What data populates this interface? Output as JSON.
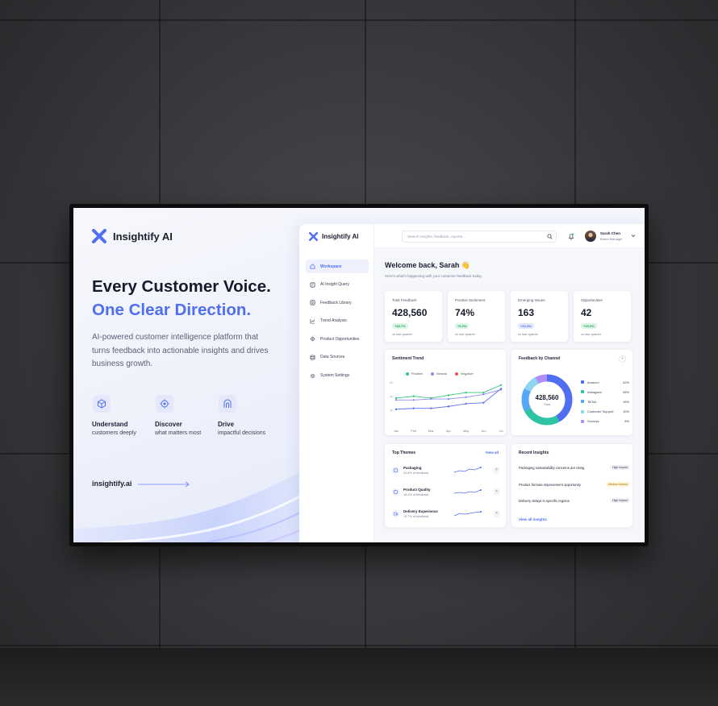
{
  "hero": {
    "brand": "Insightify AI",
    "headline_line1": "Every Customer Voice.",
    "headline_line2": "One Clear Direction.",
    "description": "AI-powered customer intelligence platform that turns feedback into actionable insights and drives business growth.",
    "features": [
      {
        "title": "Understand",
        "subtitle": "customers deeply",
        "icon": "cube-icon"
      },
      {
        "title": "Discover",
        "subtitle": "what matters most",
        "icon": "target-icon"
      },
      {
        "title": "Drive",
        "subtitle": "impactful decisions",
        "icon": "arch-icon"
      }
    ],
    "site": "insightify.ai"
  },
  "app": {
    "brand": "Insightify AI",
    "nav": [
      {
        "label": "Workspace",
        "icon": "home-icon",
        "active": true
      },
      {
        "label": "AI Insight Query",
        "icon": "query-icon",
        "active": false
      },
      {
        "label": "Feedback Library",
        "icon": "library-icon",
        "active": false
      },
      {
        "label": "Trend Analysis",
        "icon": "trend-icon",
        "active": false
      },
      {
        "label": "Product Opportunities",
        "icon": "lightbulb-icon",
        "active": false
      },
      {
        "label": "Data Sources",
        "icon": "database-icon",
        "active": false
      },
      {
        "label": "System Settings",
        "icon": "gear-icon",
        "active": false
      }
    ],
    "search_placeholder": "Search insights, feedback, reports...",
    "user": {
      "name": "Sarah Chen",
      "role": "Brand Manager"
    },
    "welcome": "Welcome back, Sarah 👋",
    "welcome_sub": "Here's what's happening with your customer feedback today.",
    "stats": [
      {
        "label": "Total Feedback",
        "value": "428,560",
        "change": "+18.7%",
        "change_color": "green",
        "sub": "vs last quarter"
      },
      {
        "label": "Positive Sentiment",
        "value": "74%",
        "change": "+6.2%",
        "change_color": "green",
        "sub": "vs last quarter"
      },
      {
        "label": "Emerging Issues",
        "value": "163",
        "change": "+23.4%",
        "change_color": "blue",
        "sub": "vs last quarter"
      },
      {
        "label": "Opportunities",
        "value": "42",
        "change": "+15.3%",
        "change_color": "green",
        "sub": "vs last quarter"
      }
    ],
    "sentiment_trend": {
      "title": "Sentiment Trend",
      "legend": [
        {
          "name": "Positive",
          "color": "#34c77b"
        },
        {
          "name": "Neutral",
          "color": "#8a8ff0"
        },
        {
          "name": "Negative",
          "color": "#ef4f4f"
        }
      ]
    },
    "channels": {
      "title": "Feedback by Channel",
      "total_value": "428,560",
      "total_label": "Total",
      "more": "+",
      "items": [
        {
          "name": "Amazon",
          "pct": "42%",
          "value": 42,
          "color": "#4f6ef2"
        },
        {
          "name": "Instagram",
          "pct": "26%",
          "value": 26,
          "color": "#2fc3a5"
        },
        {
          "name": "TikTok",
          "pct": "15%",
          "value": 15,
          "color": "#58a7f5"
        },
        {
          "name": "Customer Support",
          "pct": "10%",
          "value": 10,
          "color": "#8fd4f0"
        },
        {
          "name": "Surveys",
          "pct": "8%",
          "value": 8,
          "color": "#b08ef5"
        }
      ]
    },
    "top_themes": {
      "title": "Top Themes",
      "view_all": "View all",
      "items": [
        {
          "name": "Packaging",
          "sub": "24.8% of feedback",
          "icon": "box-icon"
        },
        {
          "name": "Product Quality",
          "sub": "18.2% of feedback",
          "icon": "quality-icon"
        },
        {
          "name": "Delivery Experience",
          "sub": "15.7% of feedback",
          "icon": "truck-icon"
        }
      ]
    },
    "recent_insights": {
      "title": "Recent Insights",
      "items": [
        {
          "text": "Packaging sustainability concerns are rising",
          "badge": "High impact",
          "level": "high"
        },
        {
          "text": "Product formula improvement opportunity",
          "badge": "Medium impact",
          "level": "medium"
        },
        {
          "text": "Delivery delays in specific regions",
          "badge": "High impact",
          "level": "high"
        }
      ],
      "view_all": "View all insights"
    }
  },
  "chart_data": {
    "type": "line",
    "title": "Sentiment Trend",
    "categories": [
      "Jan",
      "Feb",
      "Mar",
      "Apr",
      "May",
      "Jun",
      "Jul"
    ],
    "yticks": [
      "60",
      "40",
      "20"
    ],
    "series": [
      {
        "name": "Positive",
        "color": "#34c77b",
        "values": [
          46,
          48,
          46,
          49,
          52,
          52,
          60
        ]
      },
      {
        "name": "Neutral",
        "color": "#8a8ff0",
        "values": [
          44,
          44,
          45,
          45,
          47,
          50,
          55
        ]
      },
      {
        "name": "Negative",
        "color": "#5a6ff0",
        "values": [
          34,
          35,
          35,
          37,
          40,
          41,
          56
        ]
      }
    ],
    "ylim": [
      20,
      65
    ]
  }
}
